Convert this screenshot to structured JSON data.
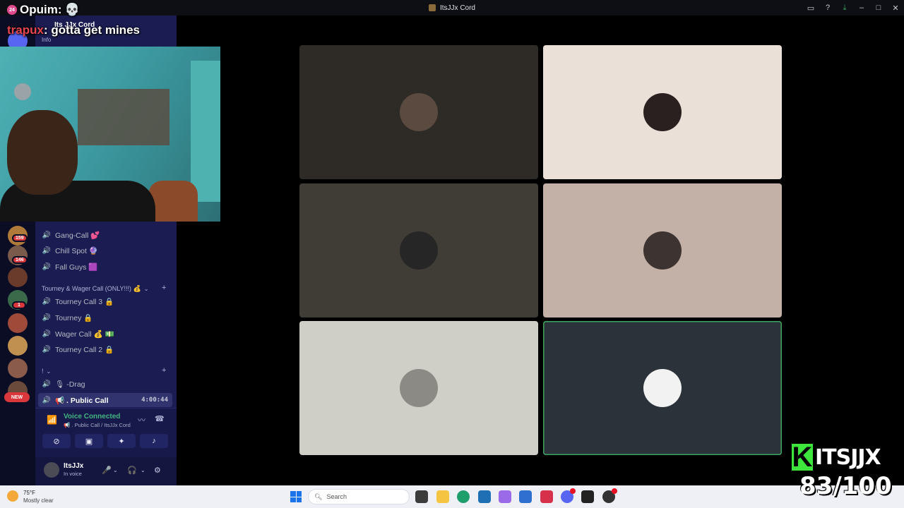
{
  "window": {
    "title": "ItsJJx Cord"
  },
  "overlay": {
    "line1_badge": "24",
    "line1_text": "Opuim:",
    "line2_nick": "trapux",
    "line2_text": ": gotta get mines"
  },
  "server": {
    "name": "Its JJx Cord",
    "info_label": "Info"
  },
  "rail": {
    "badges": [
      "159",
      "146",
      "1"
    ],
    "new_label": "NEW"
  },
  "channels_top": [
    {
      "name": "Gang-Call 💕"
    },
    {
      "name": "Chill Spot 🔮"
    },
    {
      "name": "Fall Guys 🟪"
    }
  ],
  "category_tourney": {
    "label": "Tourney & Wager Call (ONLY!!!) 💰"
  },
  "channels_tourney": [
    {
      "name": "Tourney Call 3 🔒"
    },
    {
      "name": "Tourney 🔒"
    },
    {
      "name": "Wager Call 💰 💵"
    },
    {
      "name": "Tourney Call 2 🔒"
    }
  ],
  "category_misc": {
    "label": "!"
  },
  "channels_misc": [
    {
      "name": "🎙 -Drag"
    },
    {
      "name": "📢 . Public Call",
      "timer": "4:00:44"
    }
  ],
  "voice": {
    "status": "Voice Connected",
    "location": "📢 . Public Call / ItsJJx Cord"
  },
  "user": {
    "name": "ItsJJx",
    "status": "In voice"
  },
  "tiles": [
    {
      "bg": "#2e2b27",
      "avatar": "#5a4a3f"
    },
    {
      "bg": "#ebe0d7",
      "avatar": "#2b2020"
    },
    {
      "bg": "#3f3d36",
      "avatar": "#262626"
    },
    {
      "bg": "#c3b0a7",
      "avatar": "#3d3330"
    },
    {
      "bg": "#cfcfc7",
      "avatar": "#8c8a84"
    },
    {
      "bg": "#2b323a",
      "avatar": "#f2f2f2",
      "speaking": true
    }
  ],
  "taskbar": {
    "weather_temp": "75°F",
    "weather_desc": "Mostly clear",
    "search_placeholder": "Search"
  },
  "brand": {
    "letter": "K",
    "name": "ITSJJX",
    "counter": "83/100"
  }
}
